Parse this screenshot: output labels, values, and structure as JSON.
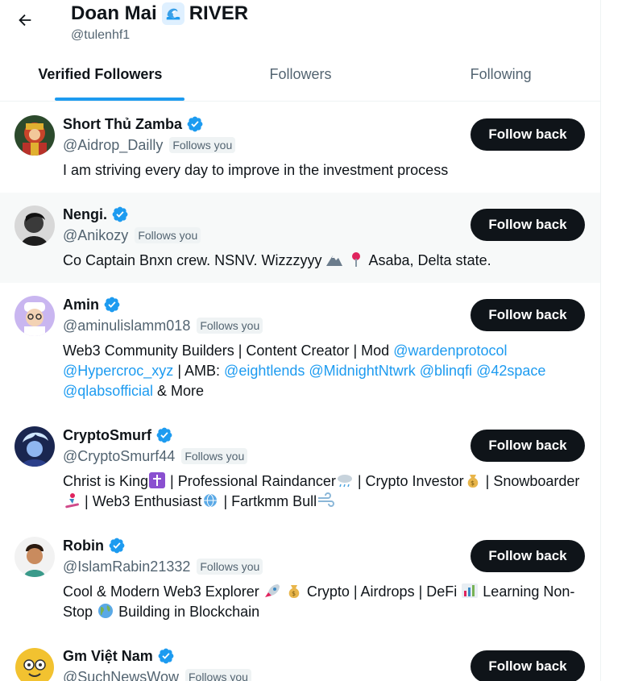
{
  "header": {
    "title": "Doan Mai",
    "title_suffix": "RIVER",
    "handle": "@tulenhf1"
  },
  "tabs": [
    {
      "label": "Verified Followers",
      "active": true
    },
    {
      "label": "Followers",
      "active": false
    },
    {
      "label": "Following",
      "active": false
    }
  ],
  "follows_you_label": "Follows you",
  "follow_button_label": "Follow back",
  "users": [
    {
      "name": "Short Thủ Zamba",
      "handle": "@Aidrop_Dailly",
      "bio": [
        "I am striving every day to improve in the investment process"
      ]
    },
    {
      "name": "Nengi.",
      "handle": "@Anikozy",
      "bio_parts": [
        "Co Captain Bnxn crew. NSNV. Wizzzyyy",
        "Asaba, Delta state."
      ]
    },
    {
      "name": "Amin",
      "handle": "@aminulislamm018",
      "bio_parts": [
        "Web3 Community Builders | Content Creator | Mod",
        "@wardenprotocol",
        "@Hypercroc_xyz",
        "| AMB:",
        "@eightlends",
        "@MidnightNtwrk",
        "@blinqfi",
        "@42space",
        "@qlabsofficial",
        "& More"
      ]
    },
    {
      "name": "CryptoSmurf",
      "handle": "@CryptoSmurf44",
      "bio_parts": [
        "Christ is King",
        "| Professional Raindancer",
        "| Crypto Investor",
        "|",
        "Snowboarder",
        "| Web3 Enthusiast",
        "| Fartkmm Bull"
      ]
    },
    {
      "name": "Robin",
      "handle": "@IslamRabin21332",
      "bio_parts": [
        "Cool & Modern Web3 Explorer",
        "Crypto | Airdrops | DeFi",
        "Learning",
        "Non-Stop",
        "Building in Blockchain"
      ]
    },
    {
      "name": "Gm Việt Nam",
      "handle": "@SuchNewsWow"
    }
  ],
  "colors": {
    "accent": "#1d9bf0",
    "text": "#0f1419",
    "secondary": "#536471",
    "button": "#0f1419",
    "hover_row": "#f7f9f9"
  }
}
